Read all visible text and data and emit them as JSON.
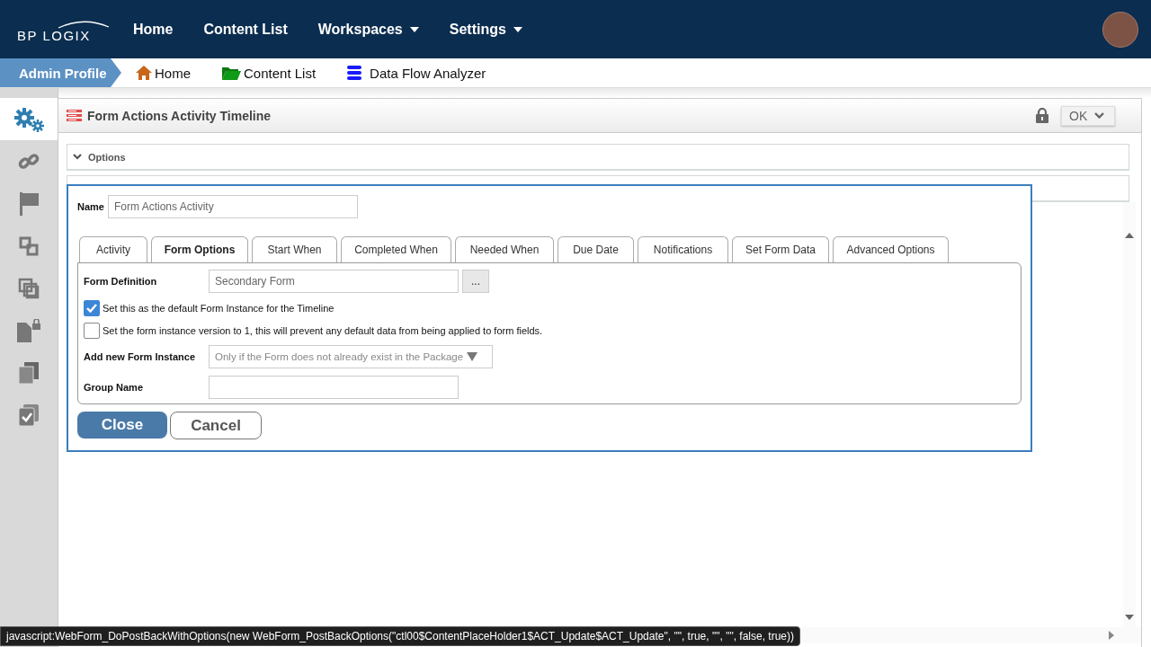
{
  "header": {
    "logo": "BP LOGIX",
    "nav": [
      {
        "label": "Home",
        "dropdown": false
      },
      {
        "label": "Content List",
        "dropdown": false
      },
      {
        "label": "Workspaces",
        "dropdown": true
      },
      {
        "label": "Settings",
        "dropdown": true
      }
    ]
  },
  "breadcrumb": {
    "profile": "Admin Profile",
    "links": [
      {
        "label": "Home",
        "kind": "house"
      },
      {
        "label": "Content List",
        "kind": "folder"
      },
      {
        "label": "Data Flow Analyzer",
        "kind": "database"
      }
    ]
  },
  "sidebar": {
    "items": [
      {
        "kind": "gears",
        "selected": true
      },
      {
        "kind": "link",
        "selected": false
      },
      {
        "kind": "flag",
        "selected": false
      },
      {
        "kind": "squares",
        "selected": false
      },
      {
        "kind": "overlap",
        "selected": false
      },
      {
        "kind": "lockdoc",
        "selected": false
      },
      {
        "kind": "copies",
        "selected": false
      },
      {
        "kind": "checkdoc",
        "selected": false
      }
    ]
  },
  "page": {
    "title": "Form Actions Activity Timeline",
    "ok_button": "OK",
    "panels": [
      {
        "label": "Options"
      }
    ]
  },
  "dialog": {
    "name_label": "Name",
    "name_value": "Form Actions Activity",
    "tabs": [
      {
        "label": "Activity",
        "selected": false
      },
      {
        "label": "Form Options",
        "selected": true
      },
      {
        "label": "Start When",
        "selected": false
      },
      {
        "label": "Completed When",
        "selected": false
      },
      {
        "label": "Needed When",
        "selected": false
      },
      {
        "label": "Due Date",
        "selected": false
      },
      {
        "label": "Notifications",
        "selected": false
      },
      {
        "label": "Set Form Data",
        "selected": false
      },
      {
        "label": "Advanced Options",
        "selected": false
      }
    ],
    "form_definition": {
      "label": "Form Definition",
      "value": "Secondary Form",
      "browse_button": "..."
    },
    "checkboxes": [
      {
        "label": "Set this as the default Form Instance for the Timeline",
        "checked": true
      },
      {
        "label": "Set the form instance version to 1, this will prevent any default data from being applied to form fields.",
        "checked": false
      }
    ],
    "add_new": {
      "label": "Add new Form Instance",
      "value": "Only if the Form does not already exist in the Package"
    },
    "group_name": {
      "label": "Group Name"
    },
    "buttons": {
      "close": "Close",
      "cancel": "Cancel"
    }
  },
  "status_text": "javascript:WebForm_DoPostBackWithOptions(new WebForm_PostBackOptions(\"ctl00$ContentPlaceHolder1$ACT_Update$ACT_Update\", \"\", true, \"\", \"\", false, true))"
}
